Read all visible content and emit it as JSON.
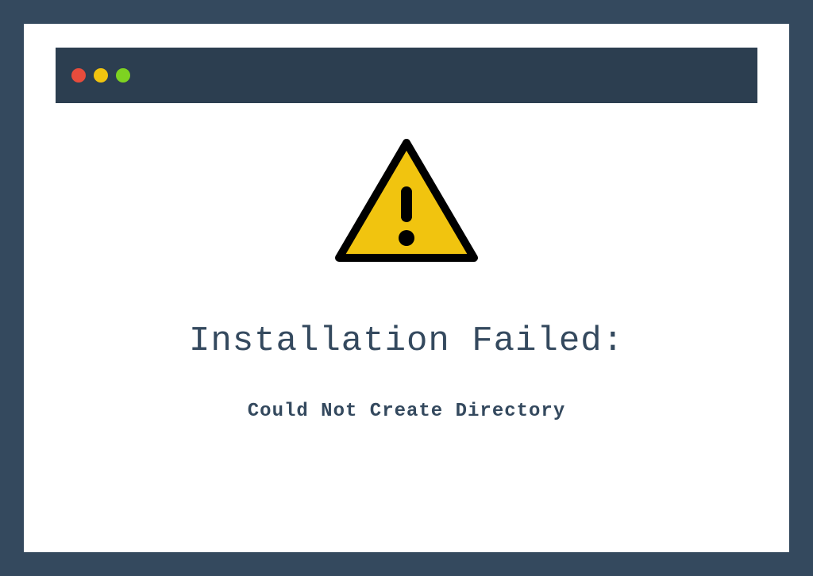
{
  "window": {
    "traffic_lights": {
      "red": "#e74c3c",
      "yellow": "#f1c40f",
      "green": "#7ed321"
    }
  },
  "error": {
    "icon": "warning-triangle-icon",
    "heading": "Installation Failed:",
    "message": "Could Not Create Directory"
  },
  "colors": {
    "frame": "#34495e",
    "titlebar": "#2c3e50",
    "warning_fill": "#f1c40f",
    "warning_stroke": "#000000"
  }
}
